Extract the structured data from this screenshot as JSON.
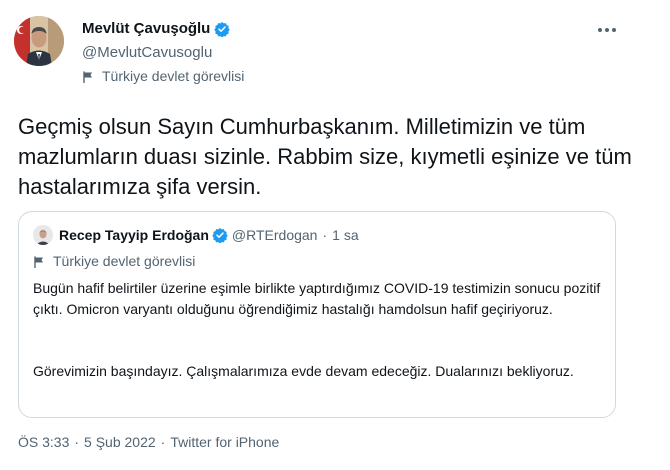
{
  "author": {
    "display_name": "Mevlüt Çavuşoğlu",
    "handle": "@MevlutCavusoglu",
    "label": "Türkiye devlet görevlisi"
  },
  "tweet": {
    "text": "Geçmiş olsun Sayın Cumhurbaşkanım. Milletimizin ve tüm mazlumların duası sizinle. Rabbim size, kıymetli eşinize ve tüm hastalarımıza şifa versin."
  },
  "quoted": {
    "display_name": "Recep Tayyip Erdoğan",
    "handle": "@RTErdogan",
    "separator": "·",
    "time": "1 sa",
    "label": "Türkiye devlet görevlisi",
    "paragraph_1": "Bugün hafif belirtiler üzerine eşimle birlikte yaptırdığımız COVID-19 testimizin sonucu pozitif çıktı. Omicron varyantı olduğunu öğrendiğimiz hastalığı hamdolsun hafif geçiriyoruz.",
    "paragraph_2": "Görevimizin başındayız. Çalışmalarımıza evde devam edeceğiz. Dualarınızı bekliyoruz."
  },
  "meta": {
    "time": "ÖS 3:33",
    "separator": "·",
    "date": "5 Şub 2022",
    "source": "Twitter for iPhone"
  },
  "icons": {
    "verified": "verified-badge-icon",
    "label": "flag-icon",
    "more": "more-options-icon"
  },
  "colors": {
    "verified_blue": "#1d9bf0",
    "secondary_text": "#536471",
    "border": "#cfd9de"
  }
}
